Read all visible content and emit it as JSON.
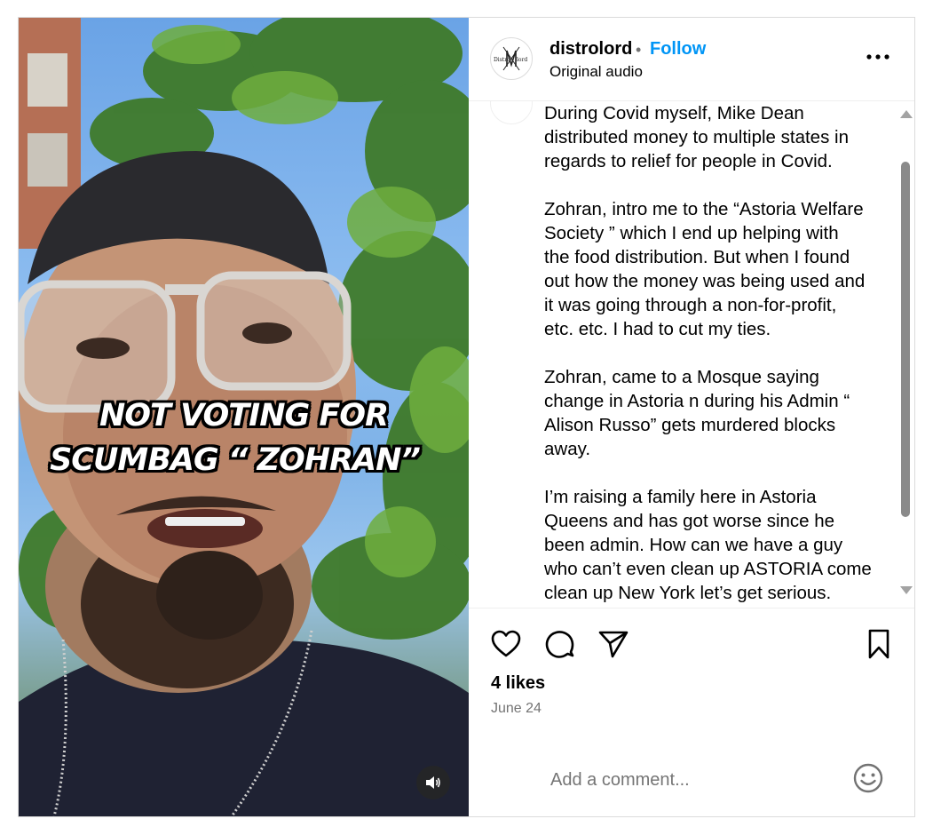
{
  "media": {
    "caption_line1": "NOT VOTING FOR",
    "caption_line2": "SCUMBAG “ ZOHRAN”",
    "sound_icon": "speaker-icon"
  },
  "header": {
    "avatar_text": "Distro Nlord",
    "username": "distrolord",
    "separator": "•",
    "follow_label": "Follow",
    "audio_label": "Original audio",
    "more_icon": "more-horizontal-icon"
  },
  "comments": {
    "body": "During Covid myself, Mike Dean\ndistributed money to multiple states in\nregards to relief for people in Covid.\n\nZohran, intro me to the “Astoria Welfare\nSociety ” which I end up helping with\nthe food distribution. But when I found\nout how the money was being used and\nit was going through a non-for-profit,\netc. etc. I had to cut my ties.\n\nZohran, came to a Mosque saying\nchange in Astoria n during his Admin “\nAlison Russo” gets murdered blocks\naway.\n\nI’m raising a family here in Astoria\nQueens and has got worse since he\nbeen admin. How can we have a guy\nwho can’t even clean up ASTORIA come\nclean up New York let’s get serious."
  },
  "actions": {
    "like_icon": "heart-icon",
    "comment_icon": "comment-icon",
    "share_icon": "send-icon",
    "save_icon": "bookmark-icon",
    "likes": "4 likes",
    "date": "June 24"
  },
  "comment_box": {
    "placeholder": "Add a comment...",
    "emoji_icon": "emoji-icon"
  },
  "colors": {
    "follow": "#0095f6",
    "muted_text": "#737373",
    "border": "#dbdbdb"
  }
}
